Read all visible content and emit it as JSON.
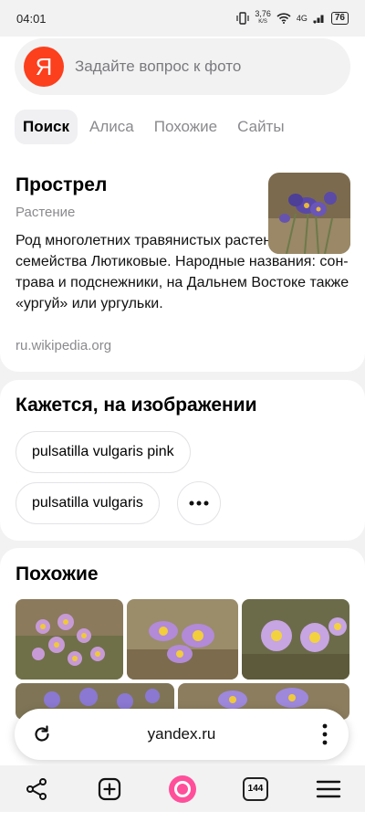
{
  "status_bar": {
    "time": "04:01",
    "net_speed": "3,76",
    "net_unit": "K/S",
    "network": "4G",
    "battery": "76"
  },
  "search": {
    "logo": "Я",
    "placeholder": "Задайте вопрос к фото"
  },
  "tabs": [
    {
      "label": "Поиск",
      "active": true
    },
    {
      "label": "Алиса",
      "active": false
    },
    {
      "label": "Похожие",
      "active": false
    },
    {
      "label": "Сайты",
      "active": false
    }
  ],
  "knowledge": {
    "title": "Прострел",
    "subtitle": "Растение",
    "description": "Род многолетних травянистых растений семейства Лютиковые. Народные названия: сон-трава и подснежники, на Дальнем Востоке также «ургуй» или ургульки.",
    "source": "ru.wikipedia.org"
  },
  "detected": {
    "title": "Кажется, на изображении",
    "chips": [
      "pulsatilla vulgaris pink",
      "pulsatilla vulgaris"
    ],
    "more_icon": "more-dots-icon"
  },
  "similar": {
    "title": "Похожие"
  },
  "browser": {
    "url": "yandex.ru",
    "tabs_count": "144"
  },
  "colors": {
    "yandex_red": "#fc3f1d",
    "alice_pink": "#ff4f9a",
    "background": "#f2f2f3"
  }
}
